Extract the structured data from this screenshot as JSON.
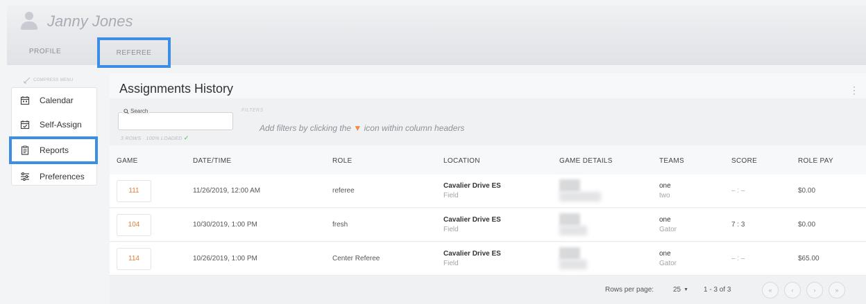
{
  "user": {
    "name": "Janny Jones"
  },
  "tabs": [
    {
      "label": "PROFILE"
    },
    {
      "label": "REFEREE"
    }
  ],
  "sidebar": {
    "compress_label": "COMPRESS MENU",
    "items": [
      {
        "label": "Calendar",
        "icon": "calendar-icon"
      },
      {
        "label": "Self-Assign",
        "icon": "calendar-check-icon"
      },
      {
        "label": "Reports",
        "icon": "clipboard-icon"
      },
      {
        "label": "Preferences",
        "icon": "sliders-icon"
      }
    ]
  },
  "main": {
    "title": "Assignments History",
    "search_label": "Search",
    "rows_loaded": "3 ROWS · 100% LOADED",
    "filters_label": "FILTERS",
    "filters_hint_pre": "Add filters by clicking the",
    "filters_hint_post": "icon within column headers",
    "accent_color": "#3b8de6",
    "columns": [
      "GAME",
      "DATE/TIME",
      "ROLE",
      "LOCATION",
      "GAME DETAILS",
      "TEAMS",
      "SCORE",
      "ROLE PAY"
    ],
    "rows": [
      {
        "game": "111",
        "datetime": "11/26/2019, 12:00 AM",
        "role": "referee",
        "location": "Cavalier Drive ES",
        "sublocation": "Field",
        "team1": "one",
        "team2": "two",
        "score": "– : –",
        "pay": "$0.00"
      },
      {
        "game": "104",
        "datetime": "10/30/2019, 1:00 PM",
        "role": "fresh",
        "location": "Cavalier Drive ES",
        "sublocation": "Field",
        "team1": "one",
        "team2": "Gator",
        "score": "7 : 3",
        "pay": "$0.00"
      },
      {
        "game": "114",
        "datetime": "10/26/2019, 1:00 PM",
        "role": "Center Referee",
        "location": "Cavalier Drive ES",
        "sublocation": "Field",
        "team1": "one",
        "team2": "Gator",
        "score": "– : –",
        "pay": "$65.00"
      }
    ]
  },
  "pager": {
    "rows_per_page_label": "Rows per page:",
    "rows_per_page_value": "25",
    "range": "1 - 3 of 3",
    "first": "«",
    "prev": "‹",
    "next": "›",
    "last": "»"
  }
}
